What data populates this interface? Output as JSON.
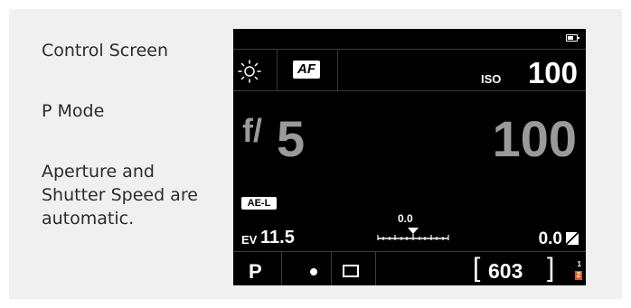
{
  "captions": {
    "title": "Control Screen",
    "mode": "P Mode",
    "description": "Aperture and Shutter Speed are automatic."
  },
  "screen": {
    "af_label": "AF",
    "iso_label": "ISO",
    "iso_value": "100",
    "aperture_prefix": "f/",
    "aperture_value": "5",
    "shutter_value": "100",
    "ae_lock_label": "AE-L",
    "ev_label": "EV",
    "ev_value": "11.5",
    "scale_value": "0.0",
    "exposure_comp_value": "0.0",
    "mode_letter": "P",
    "shots_remaining": "603",
    "slot_primary": "1",
    "slot_secondary": "2"
  },
  "icons": {
    "white_balance": "sun-icon",
    "battery": "battery-icon",
    "drive_mode": "single-shot-dot-icon",
    "frame": "frame-icon",
    "exposure_comp": "exposure-comp-icon"
  },
  "colors": {
    "screen_bg": "#000000",
    "dim_value": "#9a9a9a",
    "slot_accent": "#e8551b"
  }
}
